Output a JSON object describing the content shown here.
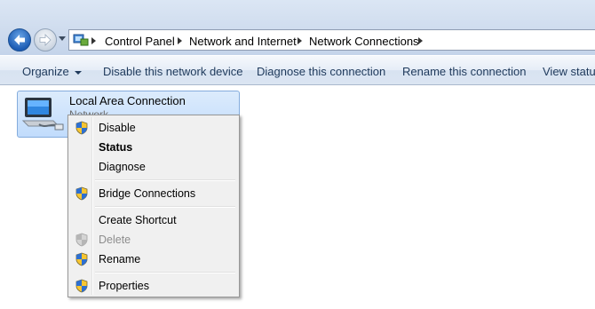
{
  "breadcrumb": {
    "items": [
      "Control Panel",
      "Network and Internet",
      "Network Connections"
    ]
  },
  "toolbar": {
    "organize": "Organize",
    "disable_device": "Disable this network device",
    "diagnose": "Diagnose this connection",
    "rename": "Rename this connection",
    "view_status": "View status"
  },
  "connection": {
    "title": "Local Area Connection",
    "subtitle": "Network"
  },
  "context_menu": {
    "disable": "Disable",
    "status": "Status",
    "diagnose": "Diagnose",
    "bridge": "Bridge Connections",
    "create_shortcut": "Create Shortcut",
    "delete": "Delete",
    "rename": "Rename",
    "properties": "Properties"
  },
  "icons": {
    "back": "back-arrow-icon",
    "forward": "forward-arrow-icon",
    "shield": "uac-shield-icon",
    "network": "network-adapter-icon"
  },
  "colors": {
    "accent": "#1d5db5",
    "selection": "#c1dcfc",
    "command_text": "#1e395b"
  }
}
